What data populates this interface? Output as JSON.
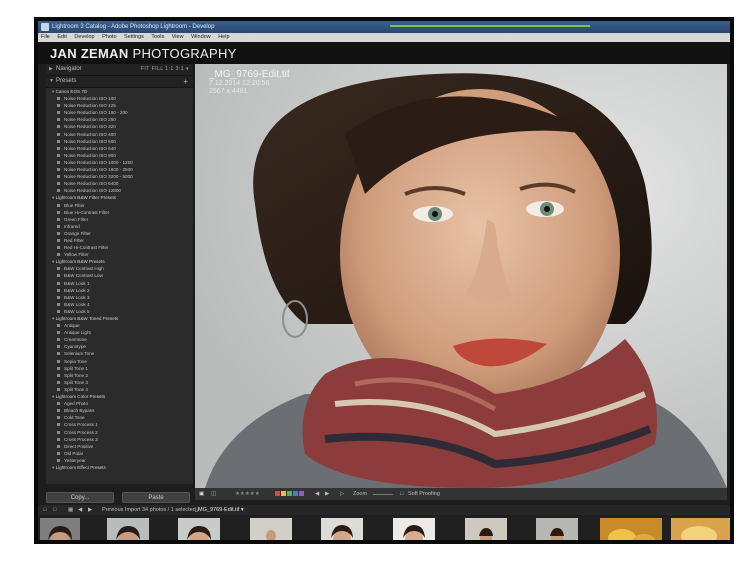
{
  "window": {
    "title": "Lightroom 3 Catalog - Adobe Photoshop Lightroom - Develop"
  },
  "menu": [
    "File",
    "Edit",
    "Develop",
    "Photo",
    "Settings",
    "Tools",
    "View",
    "Window",
    "Help"
  ],
  "identity_plate": {
    "first": "JAN ZEMAN",
    "second": "PHOTOGRAPHY"
  },
  "navigator": {
    "label": "Navigator",
    "options": "FIT  FILL  1:1  3:1 ▾"
  },
  "presets": {
    "label": "Presets",
    "groups": [
      {
        "name": "Canon EOS 7D",
        "items": [
          "Noise Reduction ISO 100",
          "Noise Reduction ISO 125",
          "Noise Reduction ISO 160 - 200",
          "Noise Reduction ISO 250",
          "Noise Reduction ISO 320",
          "Noise Reduction ISO 400",
          "Noise Reduction ISO 500",
          "Noise Reduction ISO 640",
          "Noise Reduction ISO 800",
          "Noise Reduction ISO 1000 - 1250",
          "Noise Reduction ISO 1600 - 2500",
          "Noise Reduction ISO 3200 - 5000",
          "Noise Reduction ISO 6400",
          "Noise Reduction ISO 12800"
        ]
      },
      {
        "name": "Lightroom B&W Filter Presets",
        "items": [
          "Blue Filter",
          "Blue Hi-Contrast Filter",
          "Green Filter",
          "Infrared",
          "Orange Filter",
          "Red Filter",
          "Red Hi-Contrast Filter",
          "Yellow Filter"
        ]
      },
      {
        "name": "Lightroom B&W Presets",
        "items": [
          "B&W Contrast High",
          "B&W Contrast Low",
          "B&W Look 1",
          "B&W Look 2",
          "B&W Look 3",
          "B&W Look 4",
          "B&W Look 5"
        ]
      },
      {
        "name": "Lightroom B&W Toned Presets",
        "items": [
          "Antique",
          "Antique Light",
          "Creamtone",
          "Cyanotype",
          "Selenium Tone",
          "Sepia Tone",
          "Split Tone 1",
          "Split Tone 2",
          "Split Tone 3",
          "Split Tone 4"
        ]
      },
      {
        "name": "Lightroom Color Presets",
        "items": [
          "Aged Photo",
          "Bleach Bypass",
          "Cold Tone",
          "Cross Process 1",
          "Cross Process 2",
          "Cross Process 3",
          "Direct Positive",
          "Old Polar",
          "Yesteryear"
        ]
      },
      {
        "name": "Lightroom Effect Presets",
        "items": []
      }
    ]
  },
  "left_buttons": {
    "copy": "Copy...",
    "paste": "Paste"
  },
  "image_info": {
    "filename": "_MG_9769-Edit.tif",
    "date": "7.12.2014 12:20:56",
    "dimensions": "2567 x 4481"
  },
  "toolbar": {
    "stars": "★★★★★",
    "zoom_label": "Zoom",
    "soft_proofing": "Soft Proofing",
    "flag_colors": [
      "#d94a3d",
      "#e5c23b",
      "#5bb04a",
      "#3f7fd0",
      "#9a56c4"
    ]
  },
  "filmstrip_nav": {
    "source": "Previous Import",
    "count": "34 photos / 1 selected /",
    "selected": "_MG_9769-Edit.tif ▾"
  },
  "colors": {
    "panel": "#2b2b2b",
    "background": "#1d1d1d",
    "accent": "#7cc24a"
  }
}
